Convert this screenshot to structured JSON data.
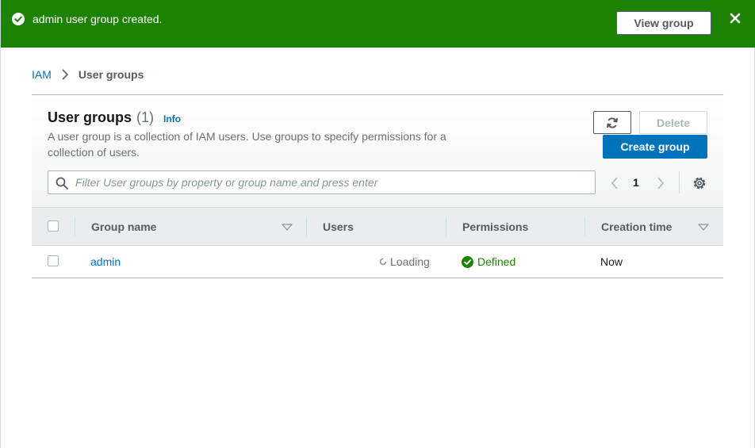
{
  "flash": {
    "message": "admin user group created.",
    "view_button": "View group",
    "color": "#1d8102"
  },
  "breadcrumb": {
    "root": "IAM",
    "current": "User groups"
  },
  "panel": {
    "title": "User groups",
    "count": "(1)",
    "info_link": "Info",
    "description": "A user group is a collection of IAM users. Use groups to specify permissions for a collection of users.",
    "delete_button": "Delete",
    "create_button": "Create group",
    "filter_placeholder": "Filter User groups by property or group name and press enter",
    "current_page": "1"
  },
  "table": {
    "columns": [
      "Group name",
      "Users",
      "Permissions",
      "Creation time"
    ],
    "rows": [
      {
        "group_name": "admin",
        "users": "Loading",
        "permissions": "Defined",
        "creation_time": "Now"
      }
    ]
  },
  "colors": {
    "link": "#0073bb",
    "success": "#1d8102",
    "primary_button": "#0073bb"
  },
  "icons": [
    "check-circle-icon",
    "close-icon",
    "chevron-right-icon",
    "refresh-icon",
    "search-icon",
    "chevron-left-icon",
    "settings-icon",
    "sort-down-icon",
    "spinner-icon"
  ]
}
